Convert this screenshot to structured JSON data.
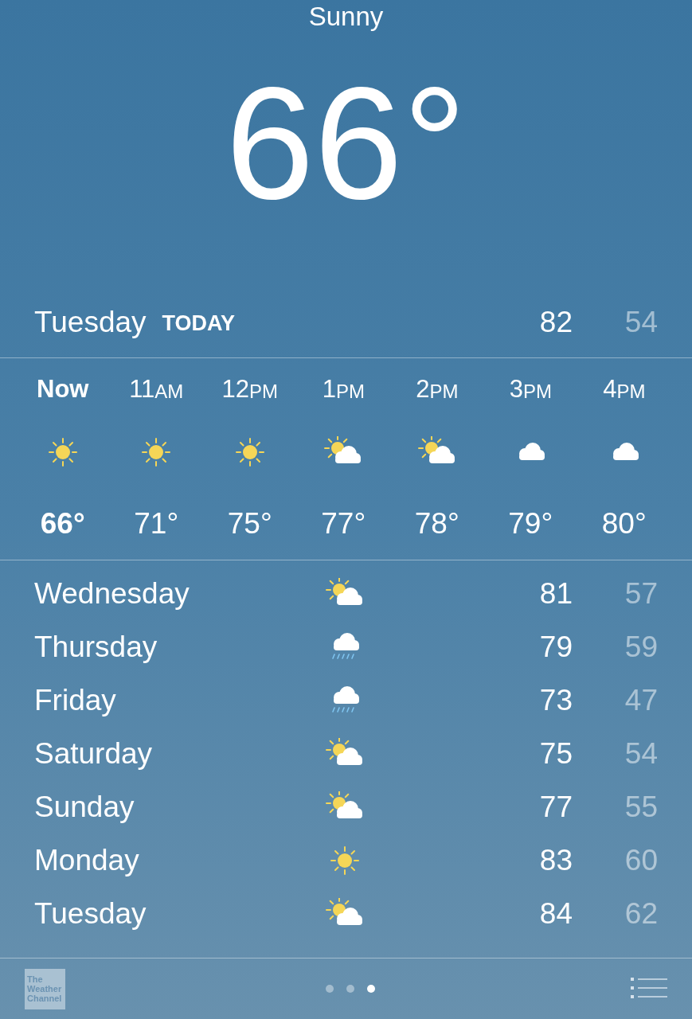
{
  "condition": "Sunny",
  "temperature": "66°",
  "today": {
    "day": "Tuesday",
    "label": "TODAY",
    "high": "82",
    "low": "54"
  },
  "hourly": [
    {
      "hour": "Now",
      "kind": "sun",
      "temp": "66°",
      "selected": true
    },
    {
      "hour": "11",
      "suffix": "AM",
      "kind": "sun",
      "temp": "71°",
      "selected": false
    },
    {
      "hour": "12",
      "suffix": "PM",
      "kind": "sun",
      "temp": "75°",
      "selected": false
    },
    {
      "hour": "1",
      "suffix": "PM",
      "kind": "partly",
      "temp": "77°",
      "selected": false
    },
    {
      "hour": "2",
      "suffix": "PM",
      "kind": "partly",
      "temp": "78°",
      "selected": false
    },
    {
      "hour": "3",
      "suffix": "PM",
      "kind": "cloud",
      "temp": "79°",
      "selected": false
    },
    {
      "hour": "4",
      "suffix": "PM",
      "kind": "cloud",
      "temp": "80°",
      "selected": false
    }
  ],
  "daily": [
    {
      "day": "Wednesday",
      "kind": "partly",
      "high": "81",
      "low": "57"
    },
    {
      "day": "Thursday",
      "kind": "rain",
      "high": "79",
      "low": "59"
    },
    {
      "day": "Friday",
      "kind": "rain",
      "high": "73",
      "low": "47"
    },
    {
      "day": "Saturday",
      "kind": "partly",
      "high": "75",
      "low": "54"
    },
    {
      "day": "Sunday",
      "kind": "partly",
      "high": "77",
      "low": "55"
    },
    {
      "day": "Monday",
      "kind": "sun",
      "high": "83",
      "low": "60"
    },
    {
      "day": "Tuesday",
      "kind": "partly",
      "high": "84",
      "low": "62"
    }
  ],
  "footer": {
    "logo": [
      "The",
      "Weather",
      "Channel"
    ],
    "pages": [
      {
        "selected": false
      },
      {
        "selected": false
      },
      {
        "selected": true
      }
    ]
  }
}
